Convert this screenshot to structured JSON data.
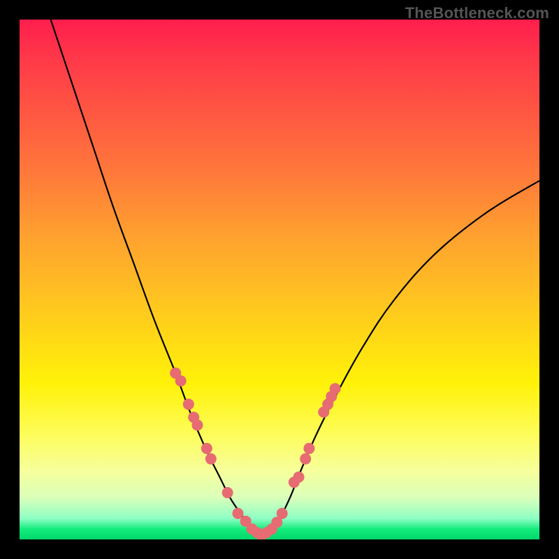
{
  "watermark": "TheBottleneck.com",
  "colors": {
    "dot": "#e66b72",
    "curve": "#000000",
    "frame": "#000000"
  },
  "chart_data": {
    "type": "line",
    "title": "",
    "xlabel": "",
    "ylabel": "",
    "xlim": [
      0,
      100
    ],
    "ylim": [
      0,
      100
    ],
    "grid": false,
    "note": "Axes have no tick labels; values below are scaled 0–100 to plot extents, estimated from pixel positions.",
    "series": [
      {
        "name": "left-curve",
        "x": [
          6,
          10,
          14,
          18,
          22,
          26,
          30,
          33,
          36,
          38.5,
          40.5,
          42.5,
          44,
          45.5,
          46.5
        ],
        "y": [
          100,
          88,
          76,
          64,
          53,
          42,
          32,
          24,
          17,
          12,
          8,
          5,
          3,
          1.2,
          0.5
        ]
      },
      {
        "name": "right-curve",
        "x": [
          46.5,
          48,
          50,
          52,
          54,
          57,
          61,
          66,
          72,
          80,
          90,
          100
        ],
        "y": [
          0.5,
          1.5,
          4,
          8,
          13,
          20,
          28,
          37,
          46,
          55,
          63,
          69
        ]
      }
    ],
    "points": [
      {
        "x": 30.0,
        "y": 32.0
      },
      {
        "x": 31.0,
        "y": 30.5
      },
      {
        "x": 32.5,
        "y": 26.0
      },
      {
        "x": 33.5,
        "y": 23.5
      },
      {
        "x": 34.2,
        "y": 22.0
      },
      {
        "x": 36.0,
        "y": 17.5
      },
      {
        "x": 36.8,
        "y": 15.5
      },
      {
        "x": 40.0,
        "y": 9.0
      },
      {
        "x": 42.0,
        "y": 5.0
      },
      {
        "x": 43.5,
        "y": 3.5
      },
      {
        "x": 44.7,
        "y": 2.0
      },
      {
        "x": 45.7,
        "y": 1.3
      },
      {
        "x": 46.5,
        "y": 0.8
      },
      {
        "x": 47.5,
        "y": 1.3
      },
      {
        "x": 48.5,
        "y": 2.0
      },
      {
        "x": 49.5,
        "y": 3.3
      },
      {
        "x": 50.5,
        "y": 5.0
      },
      {
        "x": 52.8,
        "y": 11.0
      },
      {
        "x": 53.7,
        "y": 12.0
      },
      {
        "x": 55.0,
        "y": 15.5
      },
      {
        "x": 55.7,
        "y": 17.5
      },
      {
        "x": 58.5,
        "y": 24.5
      },
      {
        "x": 59.3,
        "y": 26.0
      },
      {
        "x": 60.0,
        "y": 27.5
      },
      {
        "x": 60.7,
        "y": 29.0
      }
    ]
  }
}
